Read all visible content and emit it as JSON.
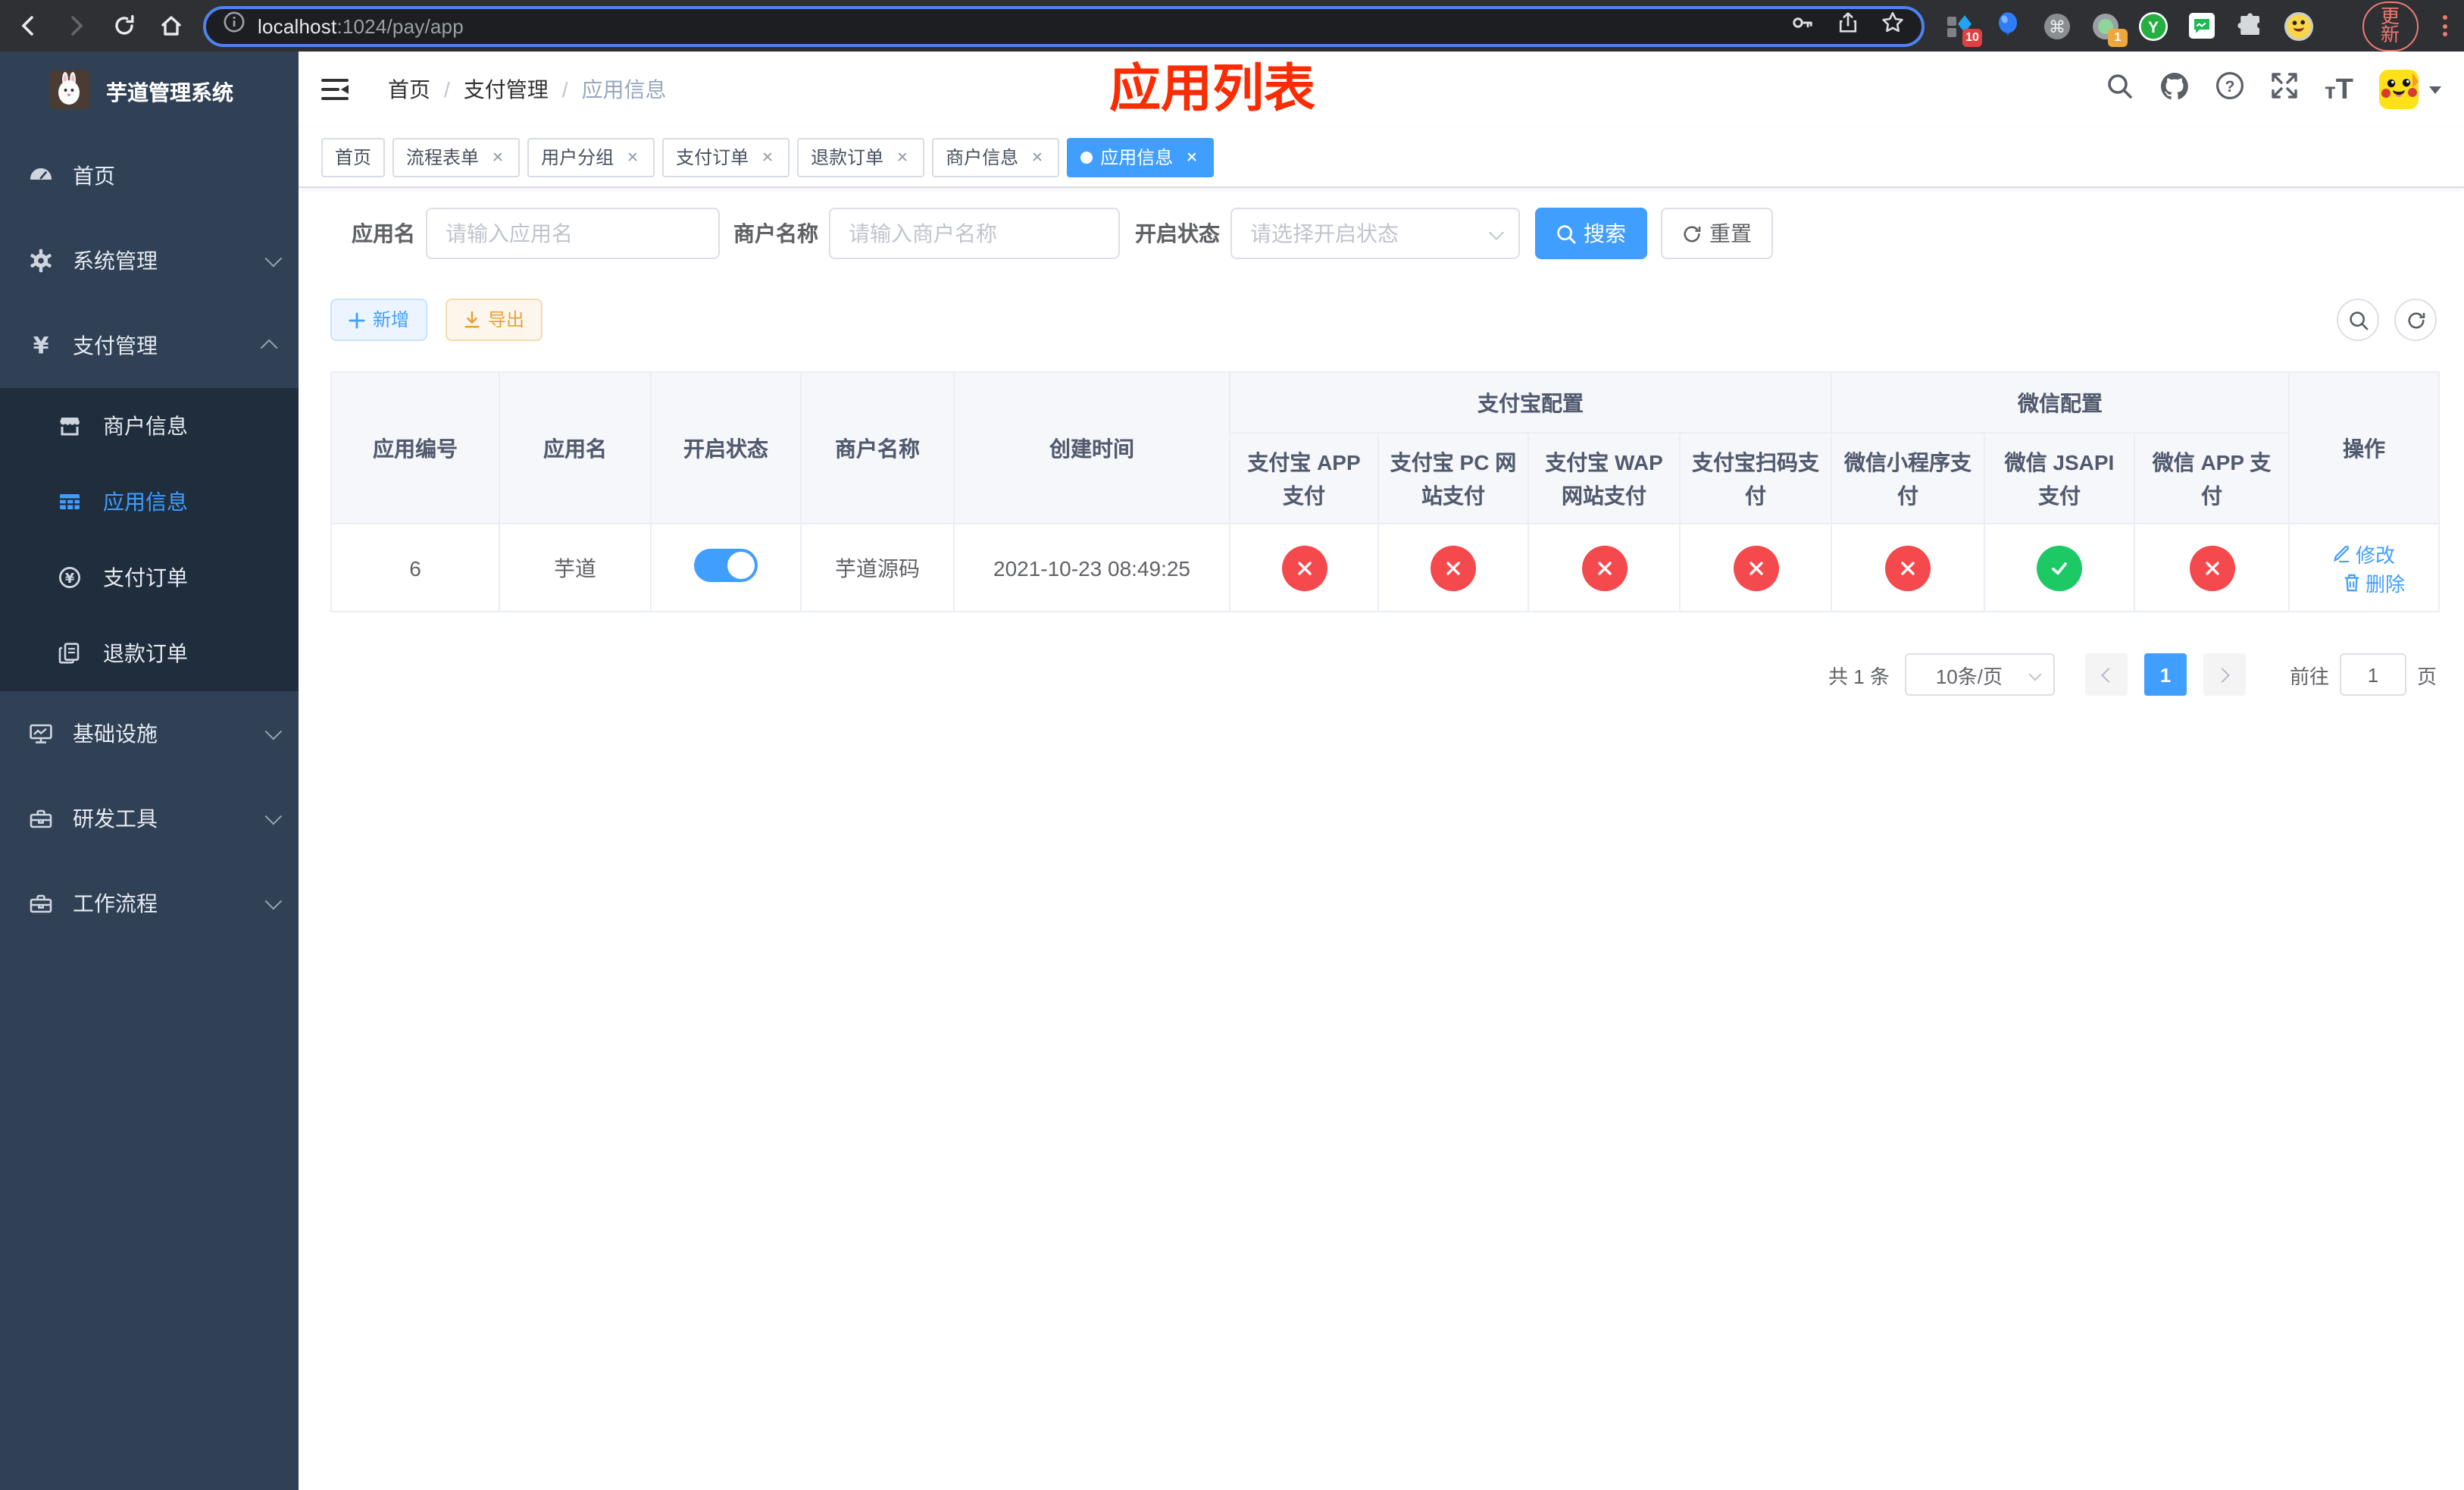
{
  "browser": {
    "url": {
      "host": "localhost",
      "path": ":1024/pay/app"
    },
    "update_button": "更新",
    "extensions": {
      "blue_diamond_badge": "10",
      "record_badge": "1",
      "y_letter": "Y"
    }
  },
  "sidebar": {
    "title": "芋道管理系统",
    "menu_top": [
      {
        "id": "home",
        "label": "首页",
        "icon": "dashboard-icon"
      },
      {
        "id": "system",
        "label": "系统管理",
        "icon": "gear-icon",
        "chevron": "down"
      },
      {
        "id": "payment",
        "label": "支付管理",
        "icon": "yen-icon",
        "chevron": "up"
      }
    ],
    "payment_submenu": [
      {
        "id": "merchant-info",
        "label": "商户信息",
        "icon": "store-icon",
        "active": false
      },
      {
        "id": "app-info",
        "label": "应用信息",
        "icon": "grid-icon",
        "active": true
      },
      {
        "id": "pay-order",
        "label": "支付订单",
        "icon": "coin-icon",
        "active": false
      },
      {
        "id": "refund-order",
        "label": "退款订单",
        "icon": "document-icon",
        "active": false
      }
    ],
    "menu_bottom": [
      {
        "id": "infrastructure",
        "label": "基础设施",
        "icon": "monitor-icon",
        "chevron": "down"
      },
      {
        "id": "dev-tools",
        "label": "研发工具",
        "icon": "toolbox-icon",
        "chevron": "down"
      },
      {
        "id": "workflow",
        "label": "工作流程",
        "icon": "toolbox-icon",
        "chevron": "down"
      }
    ]
  },
  "topbar": {
    "breadcrumb": [
      "首页",
      "支付管理",
      "应用信息"
    ],
    "separator": "/",
    "annotation": "应用列表"
  },
  "tabs": [
    {
      "id": "home",
      "label": "首页",
      "closable": false,
      "active": false
    },
    {
      "id": "flow-form",
      "label": "流程表单",
      "closable": true,
      "active": false
    },
    {
      "id": "user-group",
      "label": "用户分组",
      "closable": true,
      "active": false
    },
    {
      "id": "pay-order",
      "label": "支付订单",
      "closable": true,
      "active": false
    },
    {
      "id": "refund-order",
      "label": "退款订单",
      "closable": true,
      "active": false
    },
    {
      "id": "merchant-info",
      "label": "商户信息",
      "closable": true,
      "active": false
    },
    {
      "id": "app-info",
      "label": "应用信息",
      "closable": true,
      "active": true
    }
  ],
  "filters": {
    "app_name_label": "应用名",
    "app_name_placeholder": "请输入应用名",
    "merchant_label": "商户名称",
    "merchant_placeholder": "请输入商户名称",
    "status_label": "开启状态",
    "status_placeholder": "请选择开启状态",
    "search_button": "搜索",
    "reset_button": "重置"
  },
  "toolbar": {
    "add_button": "新增",
    "export_button": "导出"
  },
  "table": {
    "columns": [
      "应用编号",
      "应用名",
      "开启状态",
      "商户名称",
      "创建时间"
    ],
    "groups": {
      "alipay": "支付宝配置",
      "wechat": "微信配置"
    },
    "sub_columns": [
      "支付宝 APP 支付",
      "支付宝 PC 网站支付",
      "支付宝 WAP 网站支付",
      "支付宝扫码支付",
      "微信小程序支付",
      "微信 JSAPI 支付",
      "微信 APP 支付"
    ],
    "actions_column": "操作",
    "row": {
      "id": "6",
      "app_name": "芋道",
      "enabled": true,
      "merchant": "芋道源码",
      "created_at": "2021-10-23 08:49:25",
      "pay_channels": [
        {
          "name": "alipay-app-pay",
          "enabled": false
        },
        {
          "name": "alipay-pc-pay",
          "enabled": false
        },
        {
          "name": "alipay-wap-pay",
          "enabled": false
        },
        {
          "name": "alipay-qr-pay",
          "enabled": false
        },
        {
          "name": "wechat-lite-pay",
          "enabled": false
        },
        {
          "name": "wechat-jsapi-pay",
          "enabled": true
        },
        {
          "name": "wechat-app-pay",
          "enabled": false
        }
      ],
      "edit_action": "修改",
      "delete_action": "删除"
    }
  },
  "pagination": {
    "total": "共 1 条",
    "page_size": "10条/页",
    "current_page": "1",
    "goto_label": "前往",
    "goto_value": "1",
    "goto_unit": "页"
  },
  "colors": {
    "accent": "#409eff",
    "success": "#1dc965",
    "danger": "#f4494d",
    "annotation": "#fb2b02",
    "sidebar_bg": "#304156",
    "submenu_bg": "#1f2d3d"
  }
}
